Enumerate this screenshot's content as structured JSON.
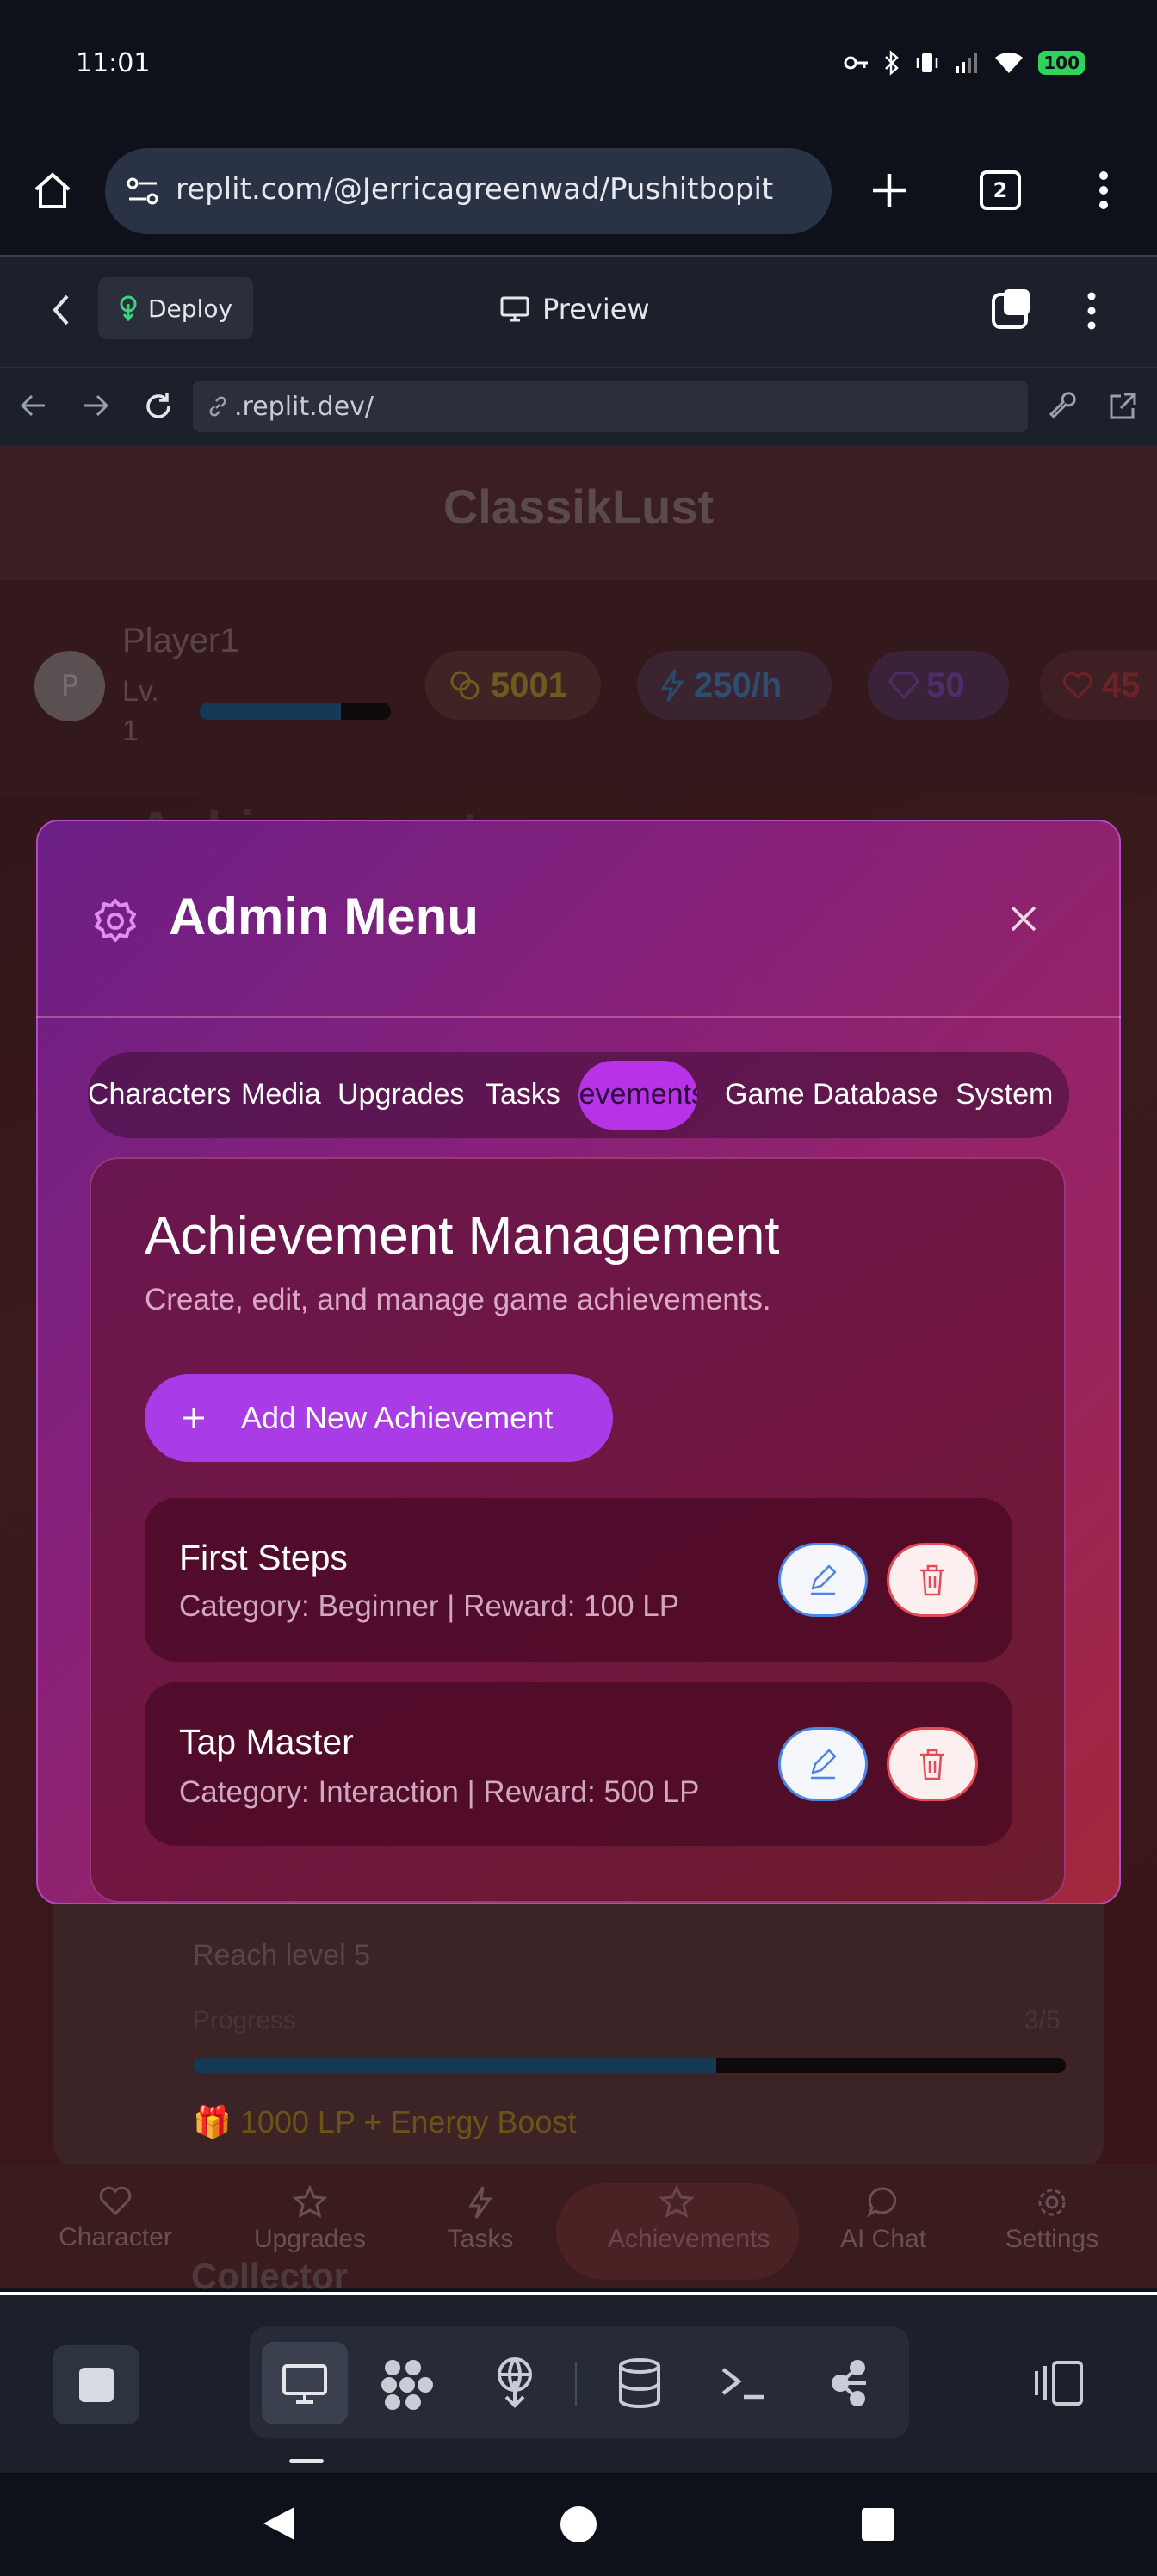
{
  "status_bar": {
    "time": "11:01",
    "battery": "100"
  },
  "browser": {
    "url": "replit.com/@Jerricagreenwad/Pushitbopit",
    "tab_count": "2"
  },
  "replit": {
    "deploy_label": "Deploy",
    "preview_label": "Preview",
    "address": ".replit.dev/"
  },
  "app": {
    "title": "ClassikLust",
    "player_name": "Player1",
    "player_level": "Lv. 1",
    "avatar_initial": "P",
    "coins": "5001",
    "rate": "250/h",
    "gems": "50",
    "hearts": "45",
    "section_heading": "Achievements",
    "bg_achievement_desc": "Reach level 5",
    "bg_progress_label": "Progress",
    "bg_progress_value": "3/5",
    "bg_progress_fraction": 0.6,
    "bg_reward": "1000 LP + Energy Boost",
    "bg_next_title": "Collector",
    "nav": [
      "Character",
      "Upgrades",
      "Tasks",
      "Achievements",
      "AI Chat",
      "Settings"
    ]
  },
  "modal": {
    "title": "Admin Menu",
    "tabs": [
      "Characters",
      "Media",
      "Upgrades",
      "Tasks",
      "Achievements",
      "Game Database",
      "System"
    ],
    "active_tab": "Achievements",
    "card_title": "Achievement Management",
    "card_subtitle": "Create, edit, and manage game achievements.",
    "add_button": "Add New Achievement",
    "achievements": [
      {
        "name": "First Steps",
        "meta": "Category: Beginner | Reward: 100 LP"
      },
      {
        "name": "Tap Master",
        "meta": "Category: Interaction | Reward: 500 LP"
      }
    ]
  },
  "colors": {
    "accent": "#a93ce6",
    "edit": "#4a86e6",
    "delete": "#e64b55"
  }
}
